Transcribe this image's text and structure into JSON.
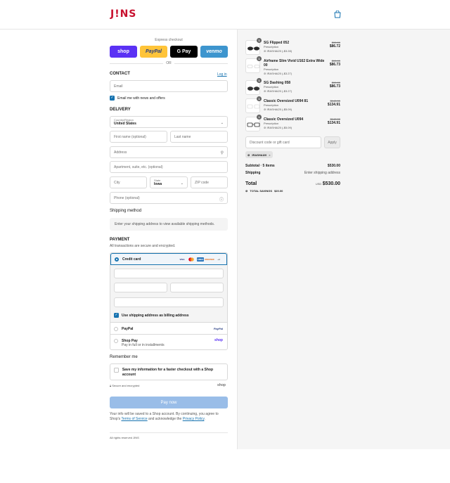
{
  "header": {
    "logo": "J!NS",
    "cart_icon": "bag-icon"
  },
  "express": {
    "label": "Express checkout",
    "buttons": [
      "shop",
      "PayPal",
      "G Pay",
      "venmo"
    ],
    "or": "OR"
  },
  "contact": {
    "title": "CONTACT",
    "login": "Log in",
    "email_placeholder": "Email",
    "news_label": "Email me with news and offers"
  },
  "delivery": {
    "title": "DELIVERY",
    "country_label": "Country/Region",
    "country_value": "United States",
    "first_name": "First name (optional)",
    "last_name": "Last name",
    "address": "Address",
    "apartment": "Apartment, suite, etc. (optional)",
    "city": "City",
    "state_label": "State",
    "state_value": "Iowa",
    "zip": "ZIP code",
    "phone": "Phone (optional)"
  },
  "shipping": {
    "title": "Shipping method",
    "notice": "Enter your shipping address to view available shipping methods."
  },
  "payment": {
    "title": "PAYMENT",
    "subtitle": "All transactions are secure and encrypted.",
    "credit_card": "Credit card",
    "card_logos": [
      "VISA",
      "MC",
      "AMEX",
      "DISCOVER",
      "+4"
    ],
    "billing_label": "Use shipping address as billing address",
    "paypal": "PayPal",
    "paypal_brand": "PayPal",
    "shop_pay": "Shop Pay",
    "shop_pay_sub": "Pay in full or in installments",
    "shop_pay_brand": "shop"
  },
  "remember": {
    "title": "Remember me",
    "label": "Save my information for a faster checkout with a Shop account",
    "secure": "Secure and encrypted",
    "shop_brand": "shop"
  },
  "pay_now": "Pay now",
  "legal": {
    "text1": "Your info will be saved to a Shop account. By continuing, you agree to Shop's ",
    "terms": "Terms of Service",
    "text2": " and acknowledge the ",
    "privacy": "Privacy Policy",
    "text3": "."
  },
  "footer": "All rights reserved JINS",
  "items": [
    {
      "qty": "1",
      "name": "SG Flipped 052",
      "type": "Prescription",
      "code": "IRASHAI20 (-$3.28)",
      "old": "$90.00",
      "new": "$86.72"
    },
    {
      "qty": "1",
      "name": "Airframe Slim Vivid U162 Extra Wide 00",
      "type": "Prescription",
      "code": "IRASHAI20 (-$3.27)",
      "old": "$90.00",
      "new": "$86.73"
    },
    {
      "qty": "1",
      "name": "SG Dashing 058",
      "type": "Prescription",
      "code": "IRASHAI20 (-$3.27)",
      "old": "$90.00",
      "new": "$86.73"
    },
    {
      "qty": "1",
      "name": "Classic Oversized U094 81",
      "type": "Prescription",
      "code": "IRASHAI20 (-$5.09)",
      "old": "$140.00",
      "new": "$134.91"
    },
    {
      "qty": "1",
      "name": "Classic Oversized U094",
      "type": "Prescription",
      "code": "IRASHAI20 (-$5.09)",
      "old": "$140.00",
      "new": "$134.91"
    }
  ],
  "discount": {
    "placeholder": "Discount code or gift card",
    "apply": "Apply",
    "code": "IRASHAI20"
  },
  "summary": {
    "subtotal_label": "Subtotal · 5 items",
    "subtotal_value": "$530.00",
    "shipping_label": "Shipping",
    "shipping_value": "Enter shipping address",
    "total_label": "Total",
    "currency": "USD",
    "total_value": "$530.00",
    "savings_label": "TOTAL SAVINGS",
    "savings_value": "$20.00"
  },
  "colors": {
    "brand": "#c8102e",
    "link": "#1773b0",
    "pay_now": "#99bde8"
  }
}
